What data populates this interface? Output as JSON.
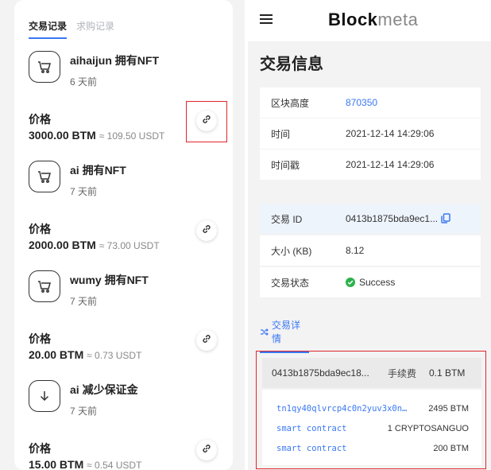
{
  "left": {
    "tabs": {
      "active": "交易记录",
      "inactive": "求购记录"
    },
    "transactions": [
      {
        "title": "aihaijun 拥有NFT",
        "time": "6 天前",
        "icon": "cart-icon",
        "price_label": "价格",
        "price": "3000.00 BTM",
        "usdt": "≈ 109.50 USDT"
      },
      {
        "title": "ai 拥有NFT",
        "time": "7 天前",
        "icon": "cart-icon",
        "price_label": "价格",
        "price": "2000.00 BTM",
        "usdt": "≈ 73.00 USDT"
      },
      {
        "title": "wumy 拥有NFT",
        "time": "7 天前",
        "icon": "cart-icon",
        "price_label": "价格",
        "price": "20.00 BTM",
        "usdt": "≈ 0.73 USDT"
      },
      {
        "title": "ai 减少保证金",
        "time": "7 天前",
        "icon": "arrow-down-icon",
        "price_label": "价格",
        "price": "15.00 BTM",
        "usdt": "≈ 0.54 USDT"
      }
    ]
  },
  "right": {
    "brand_bold": "Block",
    "brand_light": "meta",
    "page_title": "交易信息",
    "block_info": [
      {
        "label": "区块高度",
        "value": "870350"
      },
      {
        "label": "时间",
        "value": "2021-12-14 14:29:06"
      },
      {
        "label": "时间戳",
        "value": "2021-12-14 14:29:06"
      }
    ],
    "tx_info": {
      "id_label": "交易 ID",
      "id_value": "0413b1875bda9ec1...",
      "size_label": "大小 (KB)",
      "size_value": "8.12",
      "status_label": "交易状态",
      "status_value": "Success"
    },
    "detail_tab": "交易详情",
    "detail": {
      "tx_hash": "0413b1875bda9ec18...",
      "fee_label": "手续费",
      "fee_value": "0.1 BTM",
      "rows": [
        {
          "address": "tn1qy40qlvrcp4c0n2yuv3x0n…",
          "amount": "2495 BTM"
        },
        {
          "address": "smart contract",
          "amount": "1 CRYPTOSANGUO"
        },
        {
          "address": "smart contract",
          "amount": "200 BTM"
        }
      ]
    }
  },
  "colors": {
    "accent": "#3a78f2",
    "highlight": "#e0262b",
    "success": "#2bb24c"
  }
}
